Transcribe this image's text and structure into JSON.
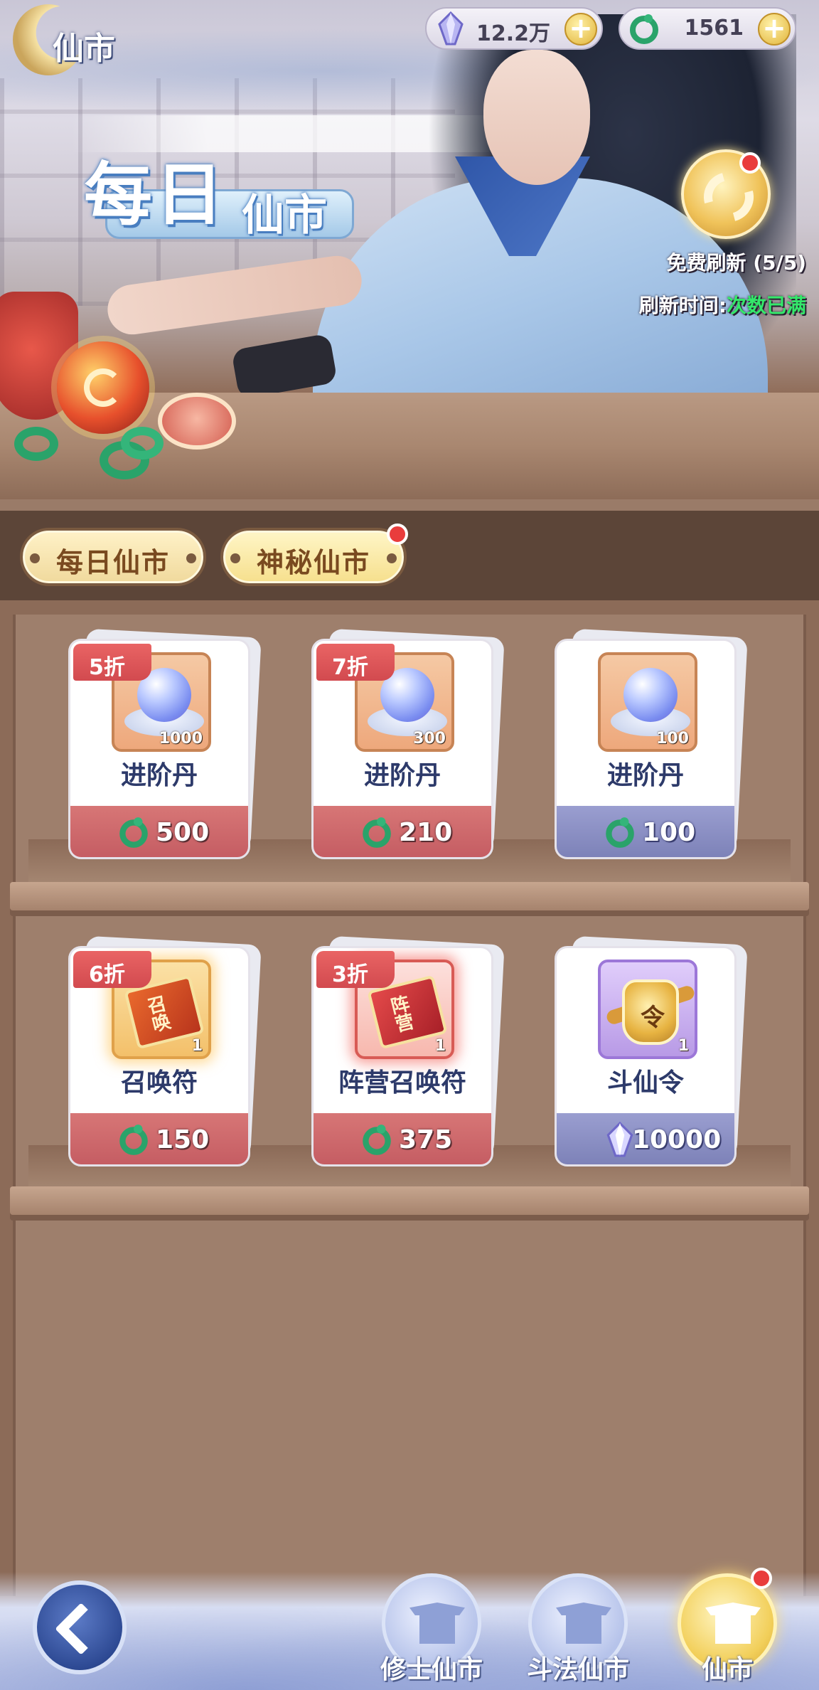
{
  "header": {
    "title": "仙市",
    "currencies": [
      {
        "name": "gem",
        "value": "12.2万",
        "plus": "+"
      },
      {
        "name": "jade",
        "value": "1561",
        "plus": "+"
      }
    ]
  },
  "banner": {
    "title_big": "每日",
    "title_small": "仙市",
    "refresh_label": "免费刷新 (5/5)",
    "refresh_time_label": "刷新时间:",
    "refresh_time_value": "次数已满"
  },
  "tabs": [
    {
      "label": "每日仙市",
      "selected": false
    },
    {
      "label": "神秘仙市",
      "selected": true,
      "badge": true
    }
  ],
  "items": [
    {
      "name": "进阶丹",
      "qty": "1000",
      "discount": "5折",
      "price": "500",
      "currency": "jade",
      "price_style": "red"
    },
    {
      "name": "进阶丹",
      "qty": "300",
      "discount": "7折",
      "price": "210",
      "currency": "jade",
      "price_style": "red"
    },
    {
      "name": "进阶丹",
      "qty": "100",
      "discount": "",
      "price": "100",
      "currency": "jade",
      "price_style": "blue"
    },
    {
      "name": "召唤符",
      "qty": "1",
      "discount": "6折",
      "price": "150",
      "currency": "jade",
      "price_style": "red",
      "icon_text": "召唤"
    },
    {
      "name": "阵营召唤符",
      "qty": "1",
      "discount": "3折",
      "price": "375",
      "currency": "jade",
      "price_style": "red",
      "icon_text": "阵营"
    },
    {
      "name": "斗仙令",
      "qty": "1",
      "discount": "",
      "price": "10000",
      "currency": "gem",
      "price_style": "blue",
      "icon_text": "令"
    }
  ],
  "bottom_nav": [
    {
      "label": "修士仙市",
      "active": false
    },
    {
      "label": "斗法仙市",
      "active": false
    },
    {
      "label": "仙市",
      "active": true,
      "badge": true
    }
  ],
  "colors": {
    "refresh_full": "#34e86a",
    "badge": "#e93c3c",
    "price_red": "#c55d63",
    "price_blue": "#7d82b8"
  }
}
